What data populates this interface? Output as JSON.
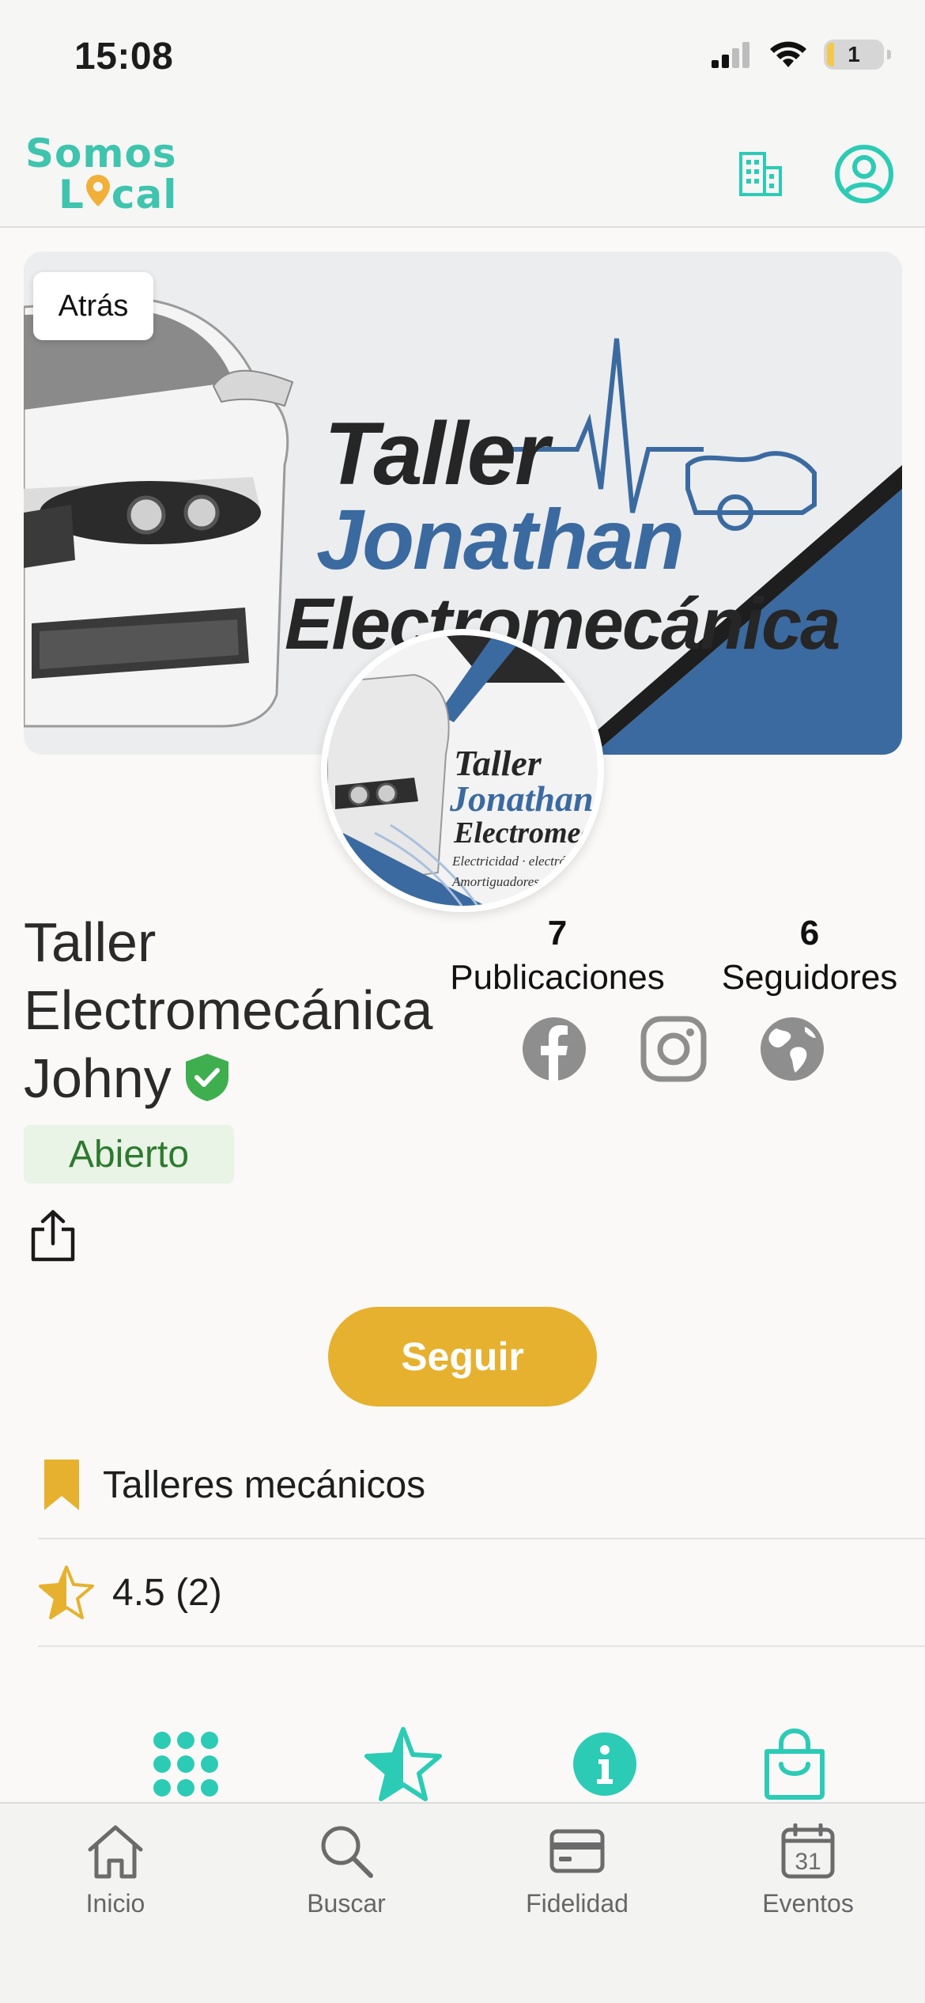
{
  "status_bar": {
    "time": "15:08",
    "battery": "1"
  },
  "header": {
    "logo_line1": "Somos",
    "logo_line2_a": "L",
    "logo_line2_b": "cal"
  },
  "banner": {
    "back_label": "Atrás",
    "line1": "Taller",
    "line2": "Jonathan",
    "line3": "Electromecánica"
  },
  "avatar": {
    "line1": "Taller",
    "line2": "Jonathan",
    "line3": "Electromecá",
    "line4": "Electricidad · electrónica · Mecá",
    "line5": "Amortiguadores · Suspens"
  },
  "business": {
    "name_line1": "Taller",
    "name_line2": "Electromecánica",
    "name_line3": "Johny",
    "status": "Abierto"
  },
  "stats": {
    "posts_count": "7",
    "posts_label": "Publicaciones",
    "followers_count": "6",
    "followers_label": "Seguidores"
  },
  "follow_label": "Seguir",
  "category": "Talleres mecánicos",
  "rating": "4.5 (2)",
  "nav": {
    "home": "Inicio",
    "search": "Buscar",
    "loyalty": "Fidelidad",
    "events": "Eventos",
    "calendar_day": "31"
  },
  "colors": {
    "accent_teal": "#2ccbb5",
    "accent_yellow": "#e6b12f",
    "status_green": "#2d7a2f",
    "banner_blue": "#3b6aa0"
  }
}
